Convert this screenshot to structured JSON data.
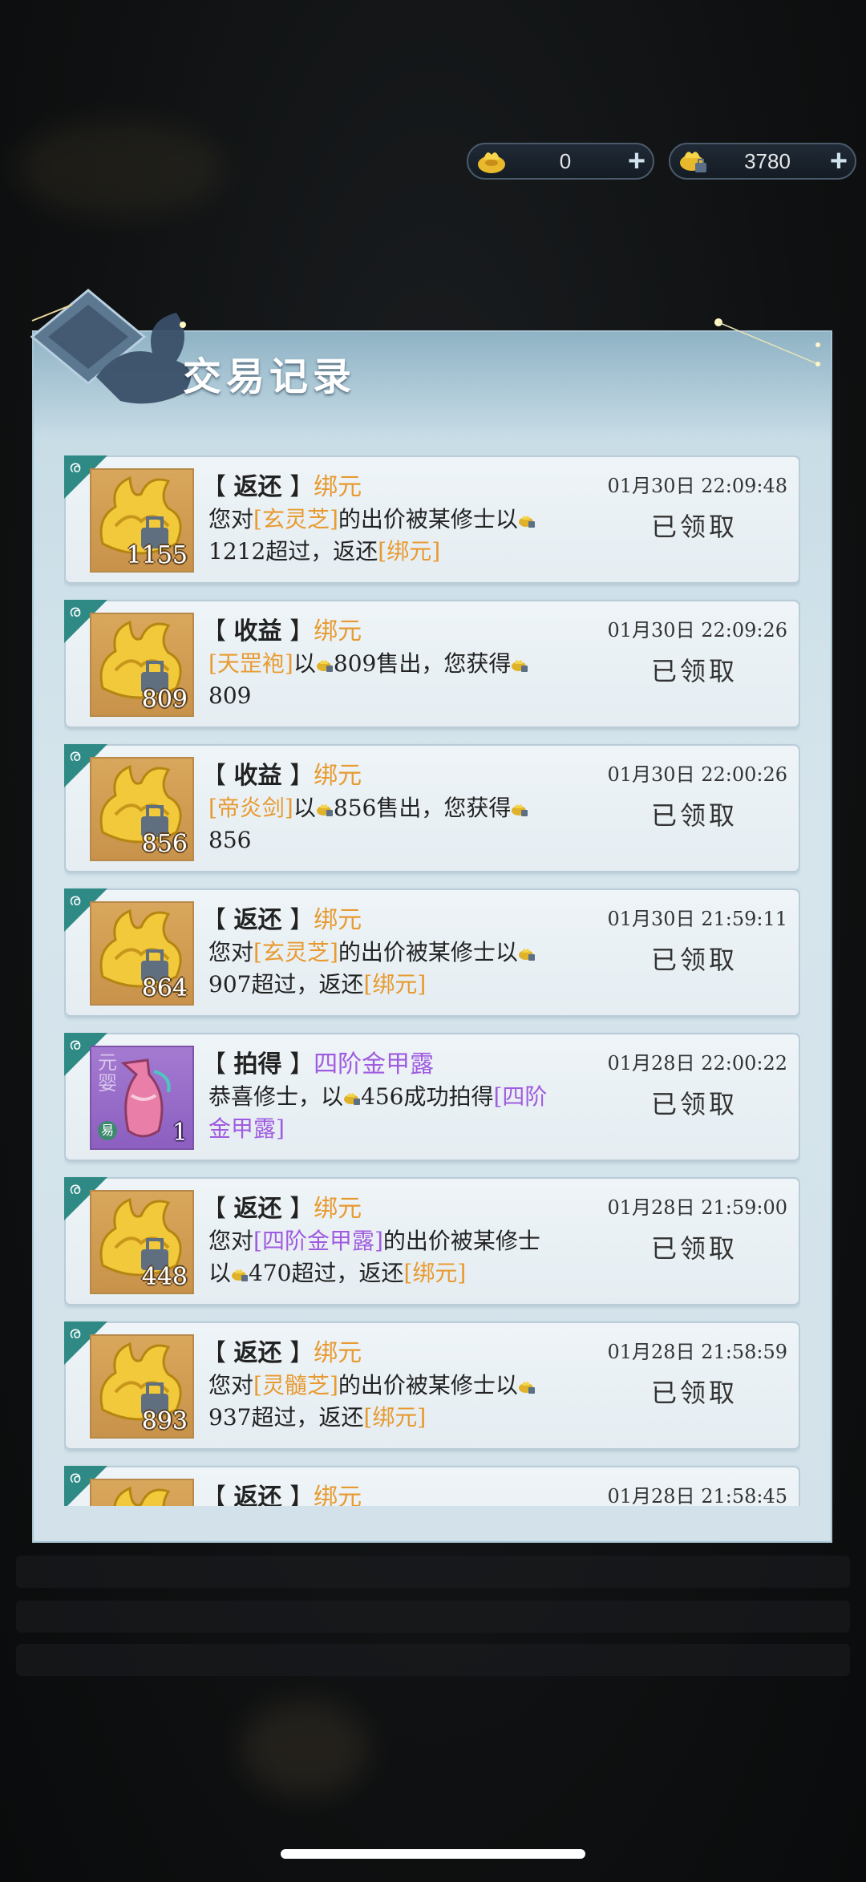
{
  "currency": [
    {
      "icon": "gold-ingot-icon",
      "value": "0"
    },
    {
      "icon": "bound-ingot-icon",
      "value": "3780"
    }
  ],
  "panel": {
    "title": "交易记录"
  },
  "records": [
    {
      "category": "返还",
      "name": "绑元",
      "time": "01月30日 22:09:48",
      "qty": "1155",
      "item": "gold",
      "parts": [
        {
          "t": "您对"
        },
        {
          "t": "[玄灵芝]",
          "hl": 1
        },
        {
          "t": "的出价被某修士以"
        },
        {
          "coin": 1
        },
        {
          "t": "1212超过，返还"
        },
        {
          "t": "[绑元]",
          "hl": 1
        }
      ],
      "status": "已领取"
    },
    {
      "category": "收益",
      "name": "绑元",
      "time": "01月30日 22:09:26",
      "qty": "809",
      "item": "gold",
      "parts": [
        {
          "t": "[天罡袍]",
          "hl": 1
        },
        {
          "t": "以"
        },
        {
          "coin": 1
        },
        {
          "t": "809售出，您获得"
        },
        {
          "coin": 1
        },
        {
          "t": "809"
        }
      ],
      "status": "已领取"
    },
    {
      "category": "收益",
      "name": "绑元",
      "time": "01月30日 22:00:26",
      "qty": "856",
      "item": "gold",
      "parts": [
        {
          "t": "[帝炎剑]",
          "hl": 1
        },
        {
          "t": "以"
        },
        {
          "coin": 1
        },
        {
          "t": "856售出，您获得"
        },
        {
          "coin": 1
        },
        {
          "t": "856"
        }
      ],
      "status": "已领取"
    },
    {
      "category": "返还",
      "name": "绑元",
      "time": "01月30日 21:59:11",
      "qty": "864",
      "item": "gold",
      "parts": [
        {
          "t": "您对"
        },
        {
          "t": "[玄灵芝]",
          "hl": 1
        },
        {
          "t": "的出价被某修士以"
        },
        {
          "coin": 1
        },
        {
          "t": "907超过，返还"
        },
        {
          "t": "[绑元]",
          "hl": 1
        }
      ],
      "status": "已领取"
    },
    {
      "category": "拍得",
      "name": "四阶金甲露",
      "time": "01月28日 22:00:22",
      "qty": "1",
      "item": "purple",
      "thumb_text": "元婴",
      "thumb_badge": "易",
      "parts": [
        {
          "t": "恭喜修士，以"
        },
        {
          "coin": 1
        },
        {
          "t": "456成功拍得"
        },
        {
          "t": "[四阶金甲露]",
          "hl": 2
        }
      ],
      "status": "已领取"
    },
    {
      "category": "返还",
      "name": "绑元",
      "time": "01月28日 21:59:00",
      "qty": "448",
      "item": "gold",
      "parts": [
        {
          "t": "您对"
        },
        {
          "t": "[四阶金甲露]",
          "hl": 2
        },
        {
          "t": "的出价被某修士以"
        },
        {
          "coin": 1
        },
        {
          "t": "470超过，返还"
        },
        {
          "t": "[绑元]",
          "hl": 1
        }
      ],
      "status": "已领取"
    },
    {
      "category": "返还",
      "name": "绑元",
      "time": "01月28日 21:58:59",
      "qty": "893",
      "item": "gold",
      "parts": [
        {
          "t": "您对"
        },
        {
          "t": "[灵髓芝]",
          "hl": 1
        },
        {
          "t": "的出价被某修士以"
        },
        {
          "coin": 1
        },
        {
          "t": "937超过，返还"
        },
        {
          "t": "[绑元]",
          "hl": 1
        }
      ],
      "status": "已领取"
    },
    {
      "category": "返还",
      "name": "绑元",
      "time": "01月28日 21:58:45",
      "qty": "",
      "item": "gold",
      "parts": [],
      "status": ""
    }
  ]
}
